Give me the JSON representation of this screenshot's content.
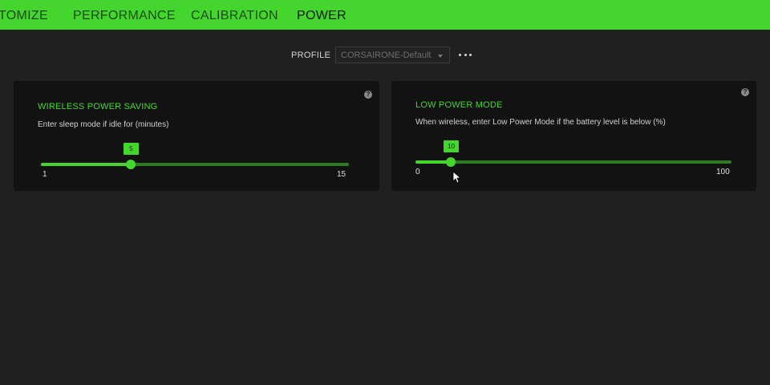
{
  "tabs": [
    {
      "label": "TOMIZE"
    },
    {
      "label": "PERFORMANCE"
    },
    {
      "label": "CALIBRATION"
    },
    {
      "label": "POWER"
    }
  ],
  "profile": {
    "label": "PROFILE",
    "value": "CORSAIRONE-Default"
  },
  "cards": {
    "wireless": {
      "title": "WIRELESS POWER SAVING",
      "description": "Enter sleep mode if idle for (minutes)",
      "value": "5",
      "min": "1",
      "max": "15"
    },
    "lowpower": {
      "title": "LOW POWER MODE",
      "description": "When wireless, enter Low Power Mode if the battery level is below (%)",
      "value": "10",
      "min": "0",
      "max": "100"
    }
  },
  "colors": {
    "accent": "#44d62c",
    "background": "#202020",
    "card": "#121212"
  },
  "icons": {
    "help": "help-icon",
    "more": "more-options-icon",
    "cursor": "mouse-cursor-icon"
  }
}
